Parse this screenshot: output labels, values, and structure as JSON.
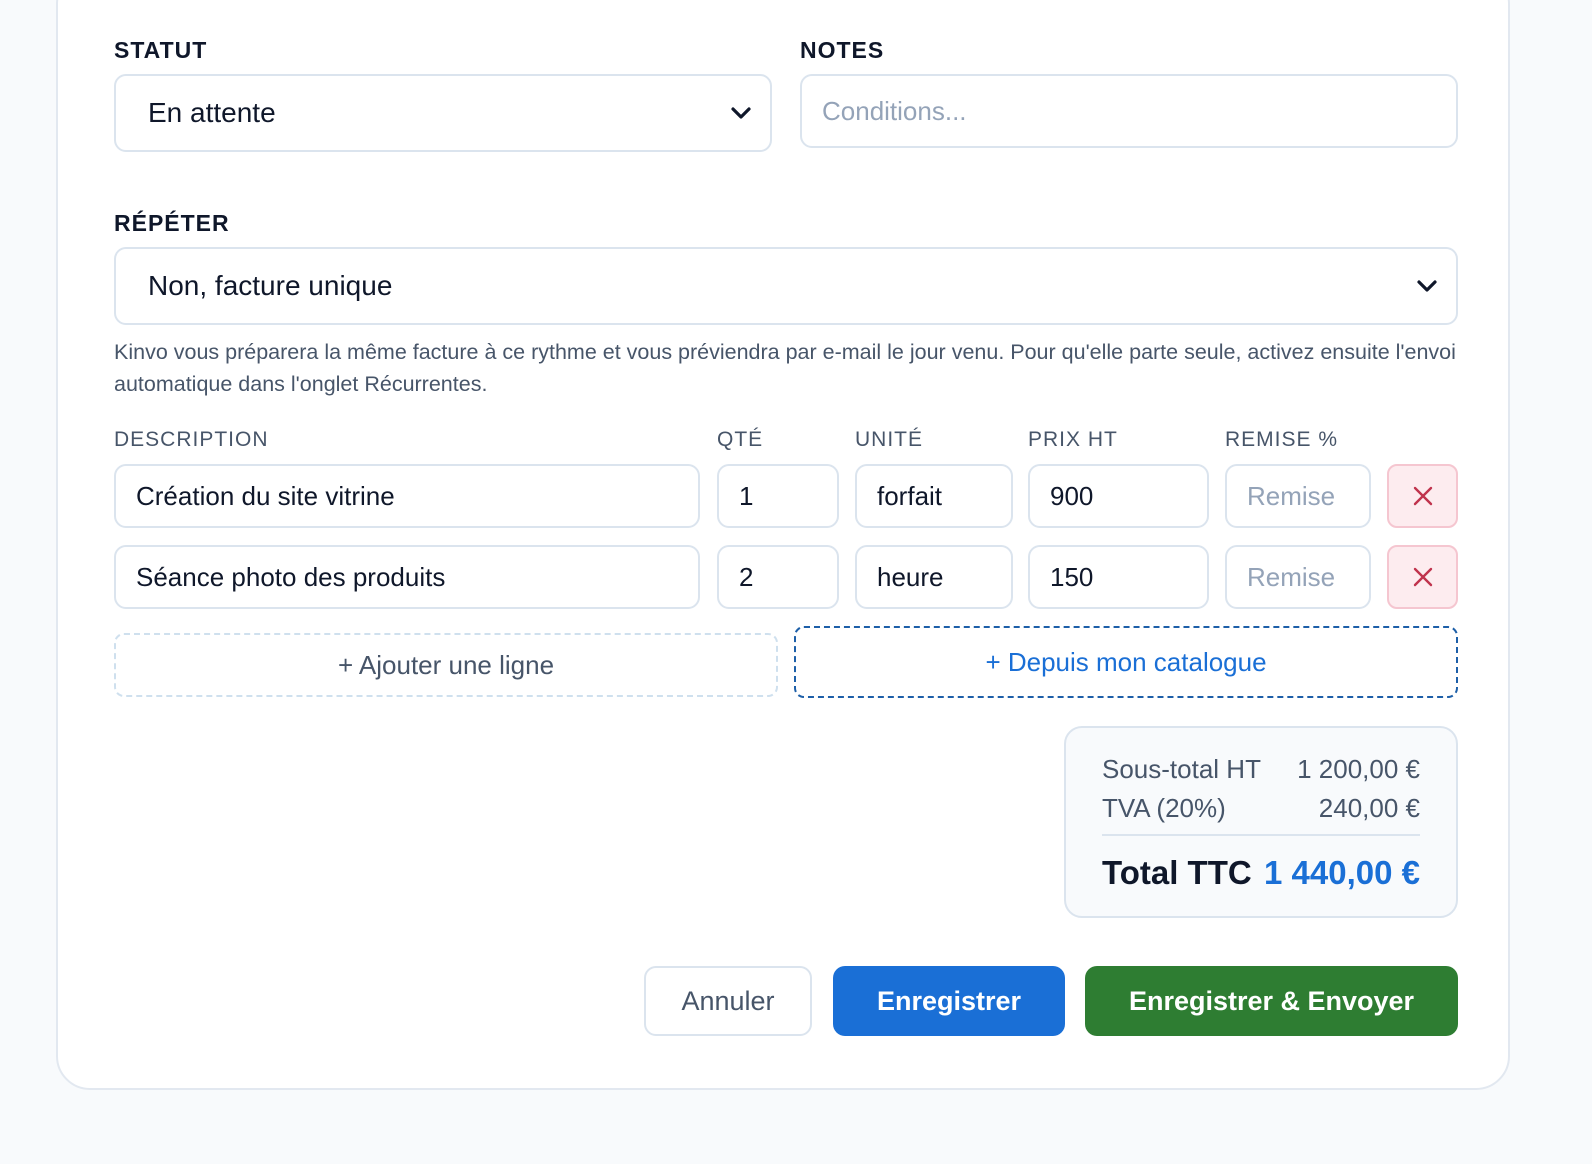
{
  "form": {
    "status": {
      "label": "STATUT",
      "value": "En attente"
    },
    "notes": {
      "label": "NOTES",
      "placeholder": "Conditions..."
    },
    "repeat": {
      "label": "RÉPÉTER",
      "value": "Non, facture unique",
      "help": "Kinvo vous préparera la même facture à ce rythme et vous préviendra par e-mail le jour venu. Pour qu'elle parte seule, activez ensuite l'envoi automatique dans l'onglet Récurrentes."
    }
  },
  "lines": {
    "headers": {
      "description": "DESCRIPTION",
      "qty": "QTÉ",
      "unit": "UNITÉ",
      "price": "PRIX HT",
      "discount": "REMISE %"
    },
    "discount_placeholder": "Remise",
    "rows": [
      {
        "description": "Création du site vitrine",
        "qty": "1",
        "unit": "forfait",
        "price": "900"
      },
      {
        "description": "Séance photo des produits",
        "qty": "2",
        "unit": "heure",
        "price": "150"
      }
    ],
    "add_line_label": "+ Ajouter une ligne",
    "catalog_label": "+ Depuis mon catalogue"
  },
  "totals": {
    "subtotal_label": "Sous-total HT",
    "subtotal_value": "1 200,00 €",
    "vat_label": "TVA (20%)",
    "vat_value": "240,00 €",
    "total_label": "Total TTC",
    "total_value": "1 440,00 €"
  },
  "actions": {
    "cancel_label": "Annuler",
    "save_label": "Enregistrer",
    "save_send_label": "Enregistrer & Envoyer"
  },
  "colors": {
    "accent": "#1a6fd6",
    "send": "#2e7d32",
    "delete_bg": "#fdecef",
    "delete_icon": "#c0334d"
  },
  "icons": {
    "select_caret": "chevron-down-icon",
    "row_delete": "close-icon"
  }
}
